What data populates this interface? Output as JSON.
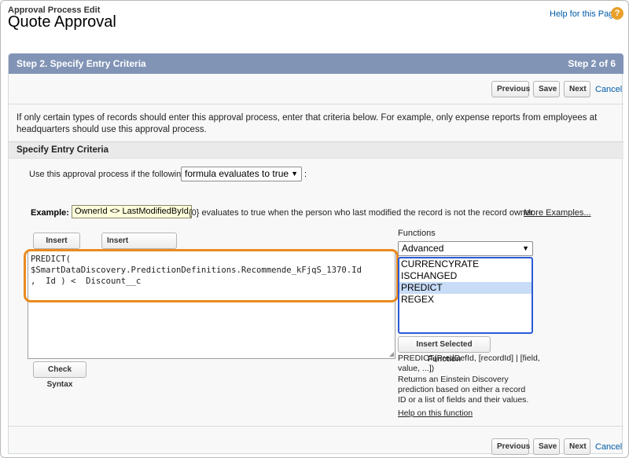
{
  "header": {
    "supertitle": "Approval Process Edit",
    "title": "Quote Approval",
    "help_link": "Help for this Page",
    "help_icon": "?"
  },
  "step": {
    "title": "Step 2. Specify Entry Criteria",
    "count": "Step 2 of 6"
  },
  "nav": {
    "previous": "Previous",
    "save": "Save",
    "next": "Next",
    "cancel": "Cancel"
  },
  "intro": "If only certain types of records should enter this approval process, enter that criteria below. For example, only expense reports from employees at headquarters should use this approval process.",
  "section": {
    "title": "Specify Entry Criteria"
  },
  "criteria": {
    "label": "Use this approval process if the following",
    "selected": "formula evaluates to true",
    "colon": ":"
  },
  "example": {
    "label": "Example:",
    "formula": "OwnerId <> LastModifiedById",
    "description": "{0} evaluates to true when the person who last modified the record is not the record owner.",
    "more_link": "More Examples..."
  },
  "editor": {
    "insert_field": "Insert Field",
    "insert_operator": "Insert Operator",
    "formula_line1": "PREDICT(",
    "formula_line2": "$SmartDataDiscovery.PredictionDefinitions.Recommende_kFjqS_1370.Id",
    "formula_line3": ",  Id ) <  Discount__c",
    "check_syntax": "Check Syntax"
  },
  "functions": {
    "label": "Functions",
    "category": "Advanced",
    "items": [
      "CURRENCYRATE",
      "ISCHANGED",
      "PREDICT",
      "REGEX"
    ],
    "selected_item": "PREDICT",
    "insert_button": "Insert Selected Function",
    "syntax": "PREDICT(PredDefId, [recordId] | [field, value, ...])",
    "description": "Returns an Einstein Discovery prediction based on either a record ID or a list of fields and their values.",
    "help_link": "Help on this function"
  },
  "colors": {
    "step_bar": "#8194b6",
    "link": "#015ba7",
    "highlight": "#ea8a1f",
    "list_selected": "#c8dcf7"
  }
}
